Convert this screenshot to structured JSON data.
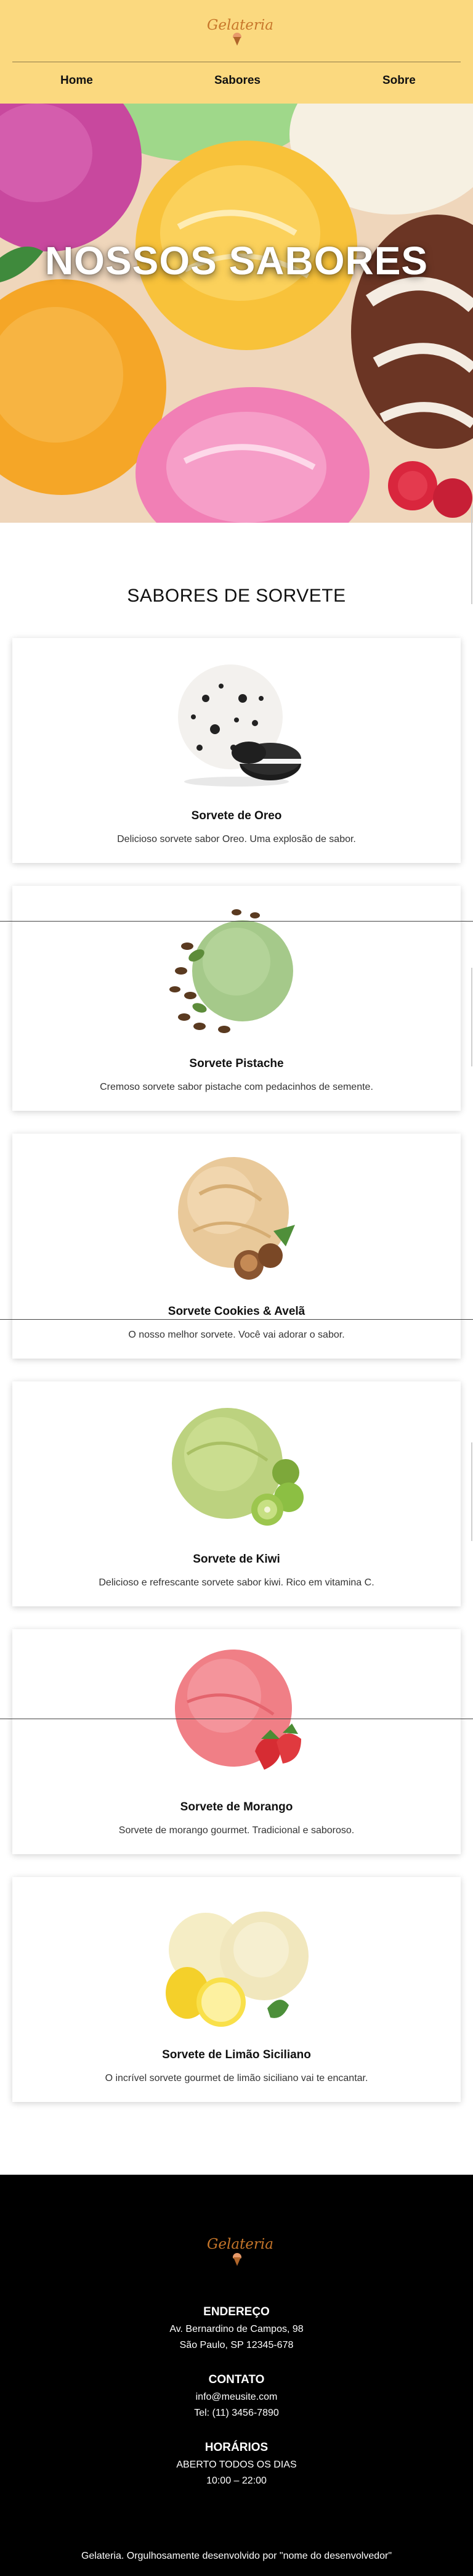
{
  "header": {
    "logo_text": "Gelateria",
    "nav": [
      {
        "label": "Home"
      },
      {
        "label": "Sabores"
      },
      {
        "label": "Sobre"
      }
    ],
    "background_color": "#fbd97f"
  },
  "hero": {
    "title": "NOSSOS SABORES"
  },
  "section": {
    "title": "SABORES DE SORVETE"
  },
  "flavors": [
    {
      "name": "Sorvete de Oreo",
      "description": "Delicioso sorvete sabor Oreo. Uma explosão de sabor.",
      "image": "oreo-ice-cream"
    },
    {
      "name": "Sorvete Pistache",
      "description": "Cremoso sorvete sabor pistache com pedacinhos de semente.",
      "image": "pistachio-ice-cream"
    },
    {
      "name": "Sorvete Cookies & Avelã",
      "description": "O nosso melhor sorvete. Você vai adorar o sabor.",
      "image": "hazelnut-ice-cream"
    },
    {
      "name": "Sorvete de Kiwi",
      "description": "Delicioso e refrescante sorvete sabor kiwi. Rico em vitamina C.",
      "image": "kiwi-ice-cream"
    },
    {
      "name": "Sorvete de Morango",
      "description": "Sorvete de morango gourmet. Tradicional e saboroso.",
      "image": "strawberry-ice-cream"
    },
    {
      "name": "Sorvete de Limão Siciliano",
      "description": "O incrível sorvete gourmet de limão siciliano vai te encantar.",
      "image": "lemon-ice-cream"
    }
  ],
  "footer": {
    "logo_text": "Gelateria",
    "address_title": "ENDEREÇO",
    "address_line1": "Av. Bernardino de Campos, 98",
    "address_line2": "São Paulo, SP 12345-678",
    "contact_title": "CONTATO",
    "contact_email": "info@meusite.com",
    "contact_phone": "Tel: (11) 3456-7890",
    "hours_title": "HORÁRIOS",
    "hours_line1": "ABERTO TODOS OS DIAS",
    "hours_line2": "10:00 – 22:00",
    "copyright": "Gelateria. Orgulhosamente desenvolvido por \"nome do desenvolvedor\""
  }
}
